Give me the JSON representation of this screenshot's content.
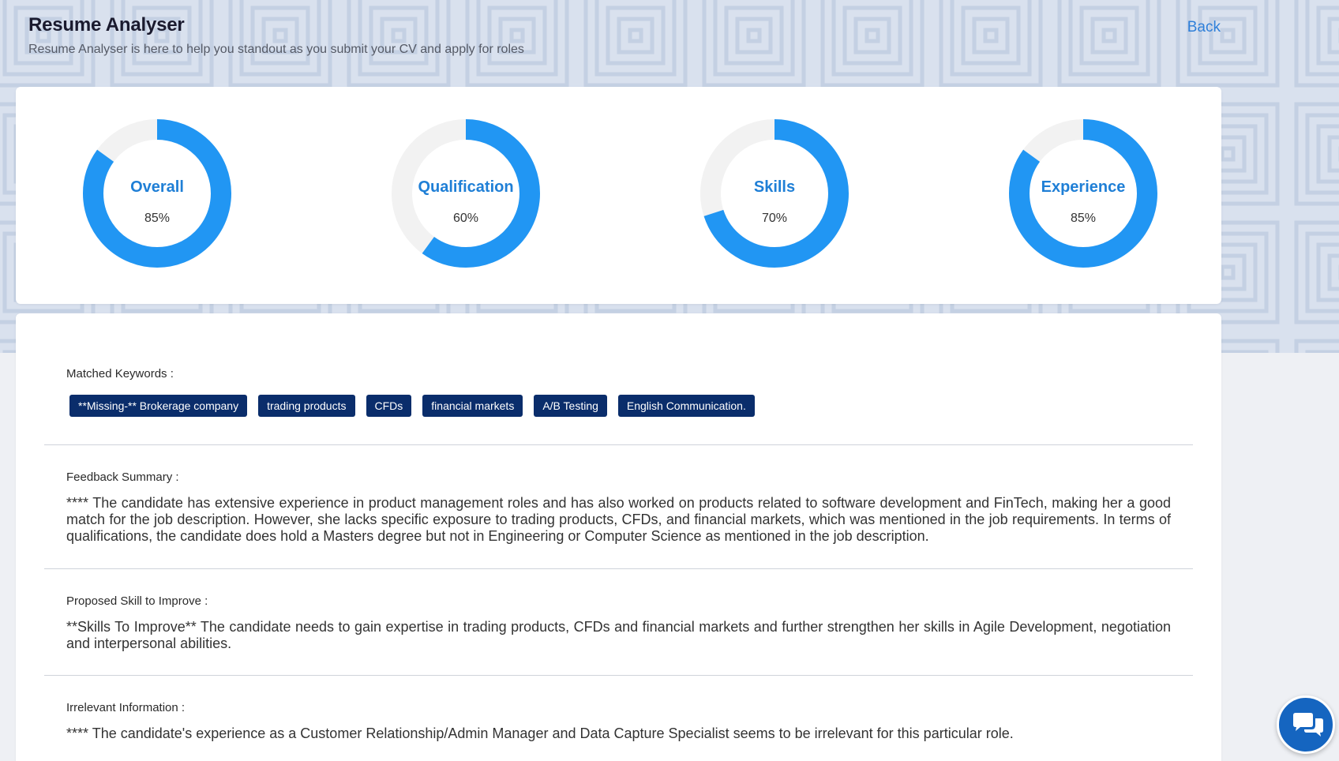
{
  "header": {
    "title": "Resume Analyser",
    "subtitle": "Resume Analyser is here to help you standout as you submit your CV and apply for roles",
    "back_label": "Back"
  },
  "scores": [
    {
      "label": "Overall",
      "value_text": "85%",
      "value": 0.85
    },
    {
      "label": "Qualification",
      "value_text": "60%",
      "value": 0.6
    },
    {
      "label": "Skills",
      "value_text": "70%",
      "value": 0.7
    },
    {
      "label": "Experience",
      "value_text": "85%",
      "value": 0.85
    }
  ],
  "matched_keywords": {
    "label": "Matched Keywords :",
    "items": [
      "**Missing-** Brokerage company",
      "trading products",
      "CFDs",
      "financial markets",
      "A/B Testing",
      "English Communication."
    ]
  },
  "feedback_summary": {
    "label": "Feedback Summary :",
    "text": "**** The candidate has extensive experience in product management roles and has also worked on products related to software development and FinTech, making her a good match for the job description. However, she lacks specific exposure to trading products, CFDs, and financial markets, which was mentioned in the job requirements. In terms of qualifications, the candidate does hold a Masters degree but not in Engineering or Computer Science as mentioned in the job description."
  },
  "proposed_skill": {
    "label": "Proposed Skill to Improve :",
    "text": "**Skills To Improve** The candidate needs to gain expertise in trading products, CFDs and financial markets and further strengthen her skills in Agile Development, negotiation and interpersonal abilities."
  },
  "irrelevant_info": {
    "label": "Irrelevant Information :",
    "text": "**** The candidate's experience as a Customer Relationship/Admin Manager and Data Capture Specialist seems to be irrelevant for this particular role."
  },
  "colors": {
    "gauge_fill": "#2196f3",
    "gauge_track": "#f2f2f2",
    "chip_bg": "#0a2d6b",
    "accent": "#1f7fd6",
    "chat_button": "#1565c0"
  },
  "icons": {
    "chat": "chat-bubbles-icon"
  }
}
